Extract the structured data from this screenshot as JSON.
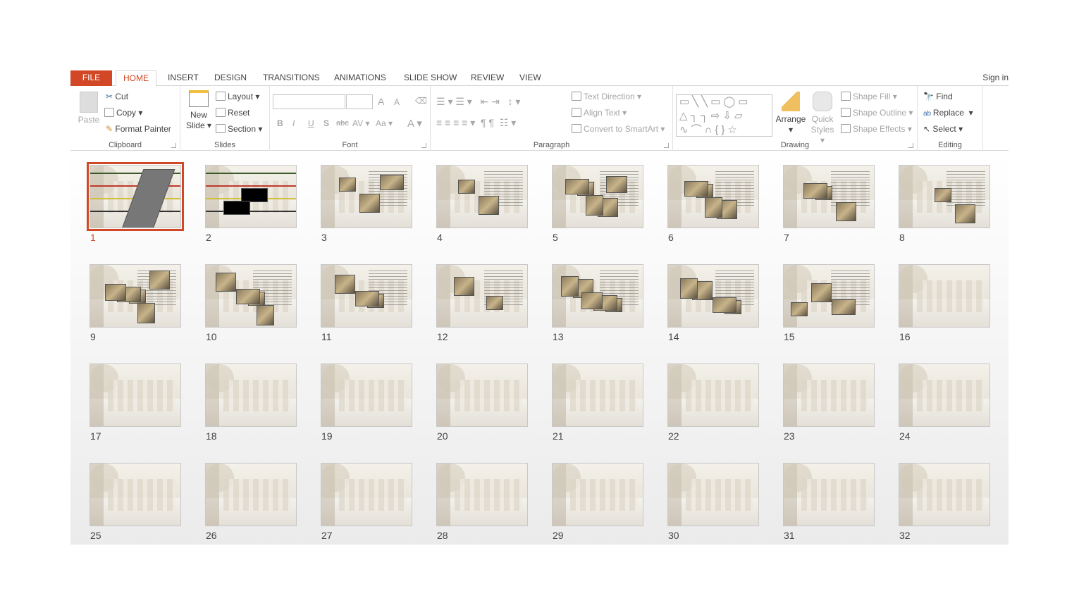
{
  "tabs": {
    "file": "FILE",
    "items": [
      "HOME",
      "INSERT",
      "DESIGN",
      "TRANSITIONS",
      "ANIMATIONS",
      "SLIDE SHOW",
      "REVIEW",
      "VIEW"
    ],
    "active": "HOME",
    "sign_in": "Sign in"
  },
  "ribbon": {
    "clipboard": {
      "label": "Clipboard",
      "paste": "Paste",
      "cut": "Cut",
      "copy": "Copy",
      "format_painter": "Format Painter"
    },
    "slides": {
      "label": "Slides",
      "new_slide_1": "New",
      "new_slide_2": "Slide",
      "layout": "Layout",
      "reset": "Reset",
      "section": "Section"
    },
    "font": {
      "label": "Font",
      "font_name": "",
      "font_size": "",
      "bold": "B",
      "italic": "I",
      "underline": "U",
      "shadow": "S",
      "strike": "abc",
      "spacing": "AV",
      "case": "Aa",
      "color": "A",
      "grow": "A",
      "shrink": "A"
    },
    "paragraph": {
      "label": "Paragraph",
      "text_direction": "Text Direction",
      "align_text": "Align Text",
      "convert_smartart": "Convert to SmartArt"
    },
    "drawing": {
      "label": "Drawing",
      "arrange": "Arrange",
      "quick_1": "Quick",
      "quick_2": "Styles",
      "shape_fill": "Shape Fill",
      "shape_outline": "Shape Outline",
      "shape_effects": "Shape Effects"
    },
    "editing": {
      "label": "Editing",
      "find": "Find",
      "replace": "Replace",
      "select": "Select"
    }
  },
  "accent": "#d24726",
  "slides": {
    "selected": 1,
    "count": 32,
    "with_content": 15
  }
}
